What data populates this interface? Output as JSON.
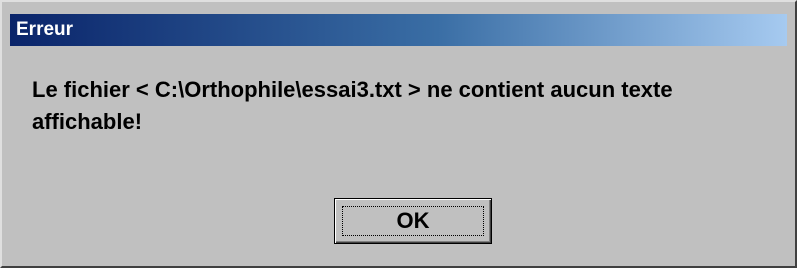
{
  "dialog": {
    "title": "Erreur",
    "message": "Le fichier < C:\\Orthophile\\essai3.txt > ne contient aucun texte affichable!",
    "ok_label": "OK"
  },
  "colors": {
    "titlebar_start": "#0a246a",
    "titlebar_end": "#a6caf0",
    "dialog_background": "#c0c0c0"
  }
}
